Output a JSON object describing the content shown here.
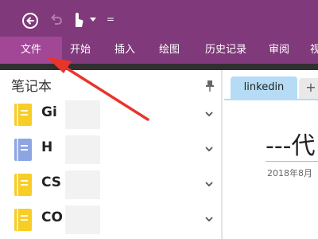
{
  "quick_access": {
    "back_icon": "back-arrow-circle-icon",
    "undo_icon": "undo-icon",
    "touch_icon": "touch-mode-icon",
    "customize_glyph": "="
  },
  "ribbon": {
    "tabs": [
      {
        "label": "文件"
      },
      {
        "label": "开始"
      },
      {
        "label": "插入"
      },
      {
        "label": "绘图"
      },
      {
        "label": "历史记录"
      },
      {
        "label": "审阅"
      },
      {
        "label": "视图"
      }
    ]
  },
  "notebooks": {
    "title": "笔记本",
    "items": [
      {
        "name": "Gi",
        "color": "#f7cd26"
      },
      {
        "name": "H",
        "color": "#8ea5e4"
      },
      {
        "name": "CS",
        "color": "#f7cd26"
      },
      {
        "name": "CO",
        "color": "#f7cd26"
      }
    ]
  },
  "page": {
    "tab_label": "linkedin",
    "add_tab_label": "+",
    "heading": "---代",
    "date": "2018年8月"
  },
  "colors": {
    "ribbon": "#80397b",
    "file_tab": "#a14796",
    "page_tab": "#b5dcf4",
    "annotation_arrow": "#e8352c"
  }
}
